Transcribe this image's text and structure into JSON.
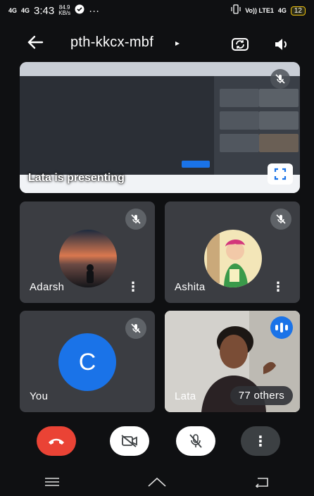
{
  "status_bar": {
    "signal_1": "4G",
    "signal_2": "4G",
    "time": "3:43",
    "speed_value": "84.9",
    "speed_unit": "KB/s",
    "overflow": "···",
    "carrier": "Vo)) LTE1",
    "network": "4G",
    "battery": "12"
  },
  "header": {
    "meeting_code": "pth-kkcx-mbf",
    "caret": "▸"
  },
  "presentation": {
    "label": "Lata is presenting"
  },
  "participants": [
    {
      "name": "Adarsh"
    },
    {
      "name": "Ashita"
    },
    {
      "name": "You",
      "initial": "C"
    },
    {
      "name": "Lata",
      "others": "77 others"
    }
  ],
  "controls": {
    "more": "⋮"
  },
  "colors": {
    "end_call": "#ea4335",
    "accent_blue": "#1a73e8",
    "tile_bg": "#3b3d42"
  },
  "icons": [
    "back-arrow-icon",
    "switch-camera-icon",
    "speaker-icon",
    "mic-off-icon",
    "fullscreen-icon",
    "end-call-icon",
    "camera-off-icon",
    "more-vert-icon",
    "speaking-icon"
  ]
}
